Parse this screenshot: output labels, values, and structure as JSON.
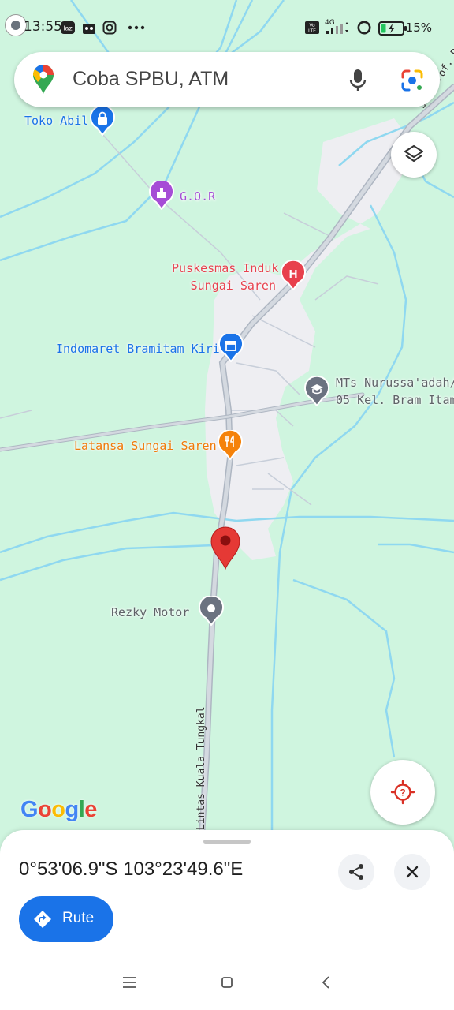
{
  "status_bar": {
    "time": "13:55",
    "battery": "15%",
    "network": "4G",
    "icons": [
      "location-icon",
      "lazada-icon",
      "app-icon",
      "instagram-icon",
      "more-dots-icon",
      "volte-icon",
      "signal-icon",
      "hotspot-icon",
      "battery-icon"
    ]
  },
  "search": {
    "placeholder": "Coba SPBU, ATM",
    "icons": [
      "maps-pin-icon",
      "mic-icon",
      "lens-icon"
    ]
  },
  "map": {
    "colors": {
      "land": "#cff5df",
      "built_area": "#eeeef2",
      "water": "#8fd8f0",
      "road": "#c6ccd6"
    },
    "pois": [
      {
        "label": "Toko Abil",
        "icon": "shopping-bag-icon",
        "color": "#1a73e8"
      },
      {
        "label": "G.O.R",
        "icon": "stadium-icon",
        "color": "#a64dd6"
      },
      {
        "label": "Puskesmas Induk\nSungai Saren",
        "icon": "hospital-icon",
        "color": "#e8404d"
      },
      {
        "label": "Indomaret Bramitam Kiri",
        "icon": "store-icon",
        "color": "#1a73e8"
      },
      {
        "label": "MTs Nurussa'adah/\n05 Kel. Bram Itam",
        "icon": "school-icon",
        "color": "#6b7280"
      },
      {
        "label": "Latansa Sungai Saren",
        "icon": "restaurant-icon",
        "color": "#f5820a"
      },
      {
        "label": "Rezky Motor",
        "icon": "place-icon",
        "color": "#6b7280"
      }
    ],
    "road_labels": [
      "Jl. Prof. Dr",
      "Lintas Kuala Tungkal"
    ],
    "dropped_pin": "red-pin-icon",
    "logo": "Google"
  },
  "controls": {
    "layers_icon": "layers-icon",
    "my_location_icon": "my-location-icon"
  },
  "place_sheet": {
    "coordinates": "0°53'06.9\"S 103°23'49.6\"E",
    "share_icon": "share-icon",
    "close_icon": "close-icon",
    "route_label": "Rute",
    "route_icon": "directions-icon"
  },
  "nav_bar": {
    "items": [
      "menu-icon",
      "home-icon",
      "back-icon"
    ]
  }
}
